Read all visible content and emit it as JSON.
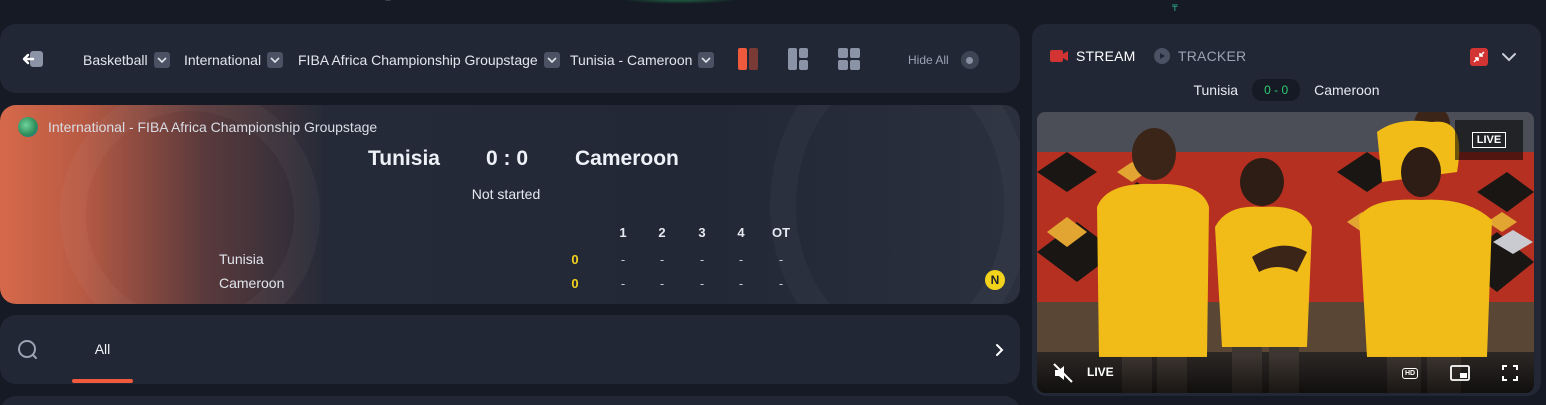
{
  "breadcrumbs": [
    {
      "label": "Basketball"
    },
    {
      "label": "International"
    },
    {
      "label": "FIBA Africa Championship Groupstage"
    },
    {
      "label": "Tunisia - Cameroon"
    }
  ],
  "toolbar": {
    "hide_all_label": "Hide All"
  },
  "scoreboard": {
    "league": "International - FIBA Africa Championship Groupstage",
    "home_team": "Tunisia",
    "away_team": "Cameroon",
    "score": "0 : 0",
    "status": "Not started",
    "period_headers": [
      "1",
      "2",
      "3",
      "4",
      "OT"
    ],
    "rows": [
      {
        "team": "Tunisia",
        "total": "0",
        "periods": [
          "-",
          "-",
          "-",
          "-",
          "-"
        ]
      },
      {
        "team": "Cameroon",
        "total": "0",
        "periods": [
          "-",
          "-",
          "-",
          "-",
          "-"
        ]
      }
    ],
    "badge": "N"
  },
  "market_tabs": {
    "active": "All"
  },
  "stream_panel": {
    "tabs": [
      {
        "label": "STREAM",
        "icon": "video-camera-icon"
      },
      {
        "label": "TRACKER",
        "icon": "play-circle-icon"
      }
    ],
    "home_team": "Tunisia",
    "away_team": "Cameroon",
    "score": "0 - 0",
    "video": {
      "live_badge": "LIVE",
      "live_text": "LIVE",
      "hd_label": "HD"
    }
  },
  "colors": {
    "accent": "#ef5a3c",
    "score_total": "#f3d21c",
    "stream_score": "#2ecc71",
    "panel_bg": "#212735",
    "page_bg": "#151a24"
  }
}
